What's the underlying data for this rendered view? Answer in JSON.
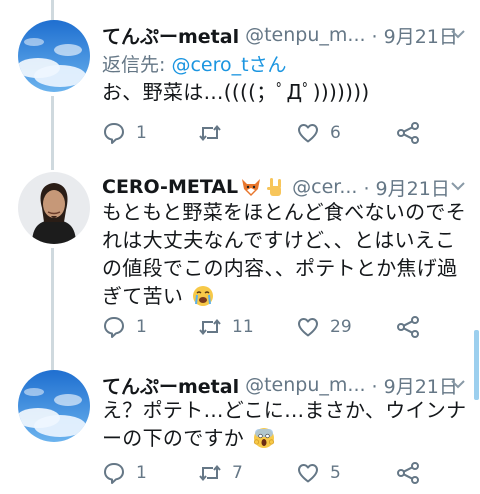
{
  "tweets": [
    {
      "name": "てんぷーmetal",
      "handle": "@tenpu_m...",
      "date": "· 9月21日",
      "reply_label": "返信先:",
      "reply_to": "@cero_tさん",
      "text": "お、野菜は…((((；ﾟДﾟ)))))))",
      "replies": "1",
      "retweets": "",
      "likes": "6"
    },
    {
      "name": "CERO-METAL",
      "handle": "@cer...",
      "date": "· 9月21日",
      "text": "もともと野菜をほとんど食べないのでそれは大丈夫なんですけど、、とはいえこの値段でこの内容、、ポテトとか焦げ過ぎて苦い",
      "replies": "1",
      "retweets": "11",
      "likes": "29"
    },
    {
      "name": "てんぷーmetal",
      "handle": "@tenpu_m...",
      "date": "· 9月21日",
      "text": "え？ポテト…どこに…まさか、ウインナーの下のですか",
      "replies": "1",
      "retweets": "7",
      "likes": "5"
    }
  ],
  "icons": {
    "reply": "reply-icon",
    "retweet": "retweet-icon",
    "like": "heart-icon",
    "share": "share-icon",
    "more": "chevron-down-icon"
  },
  "colors": {
    "handle": "#657786",
    "mention": "#1b95e0",
    "thread_line": "#cfd9de"
  }
}
